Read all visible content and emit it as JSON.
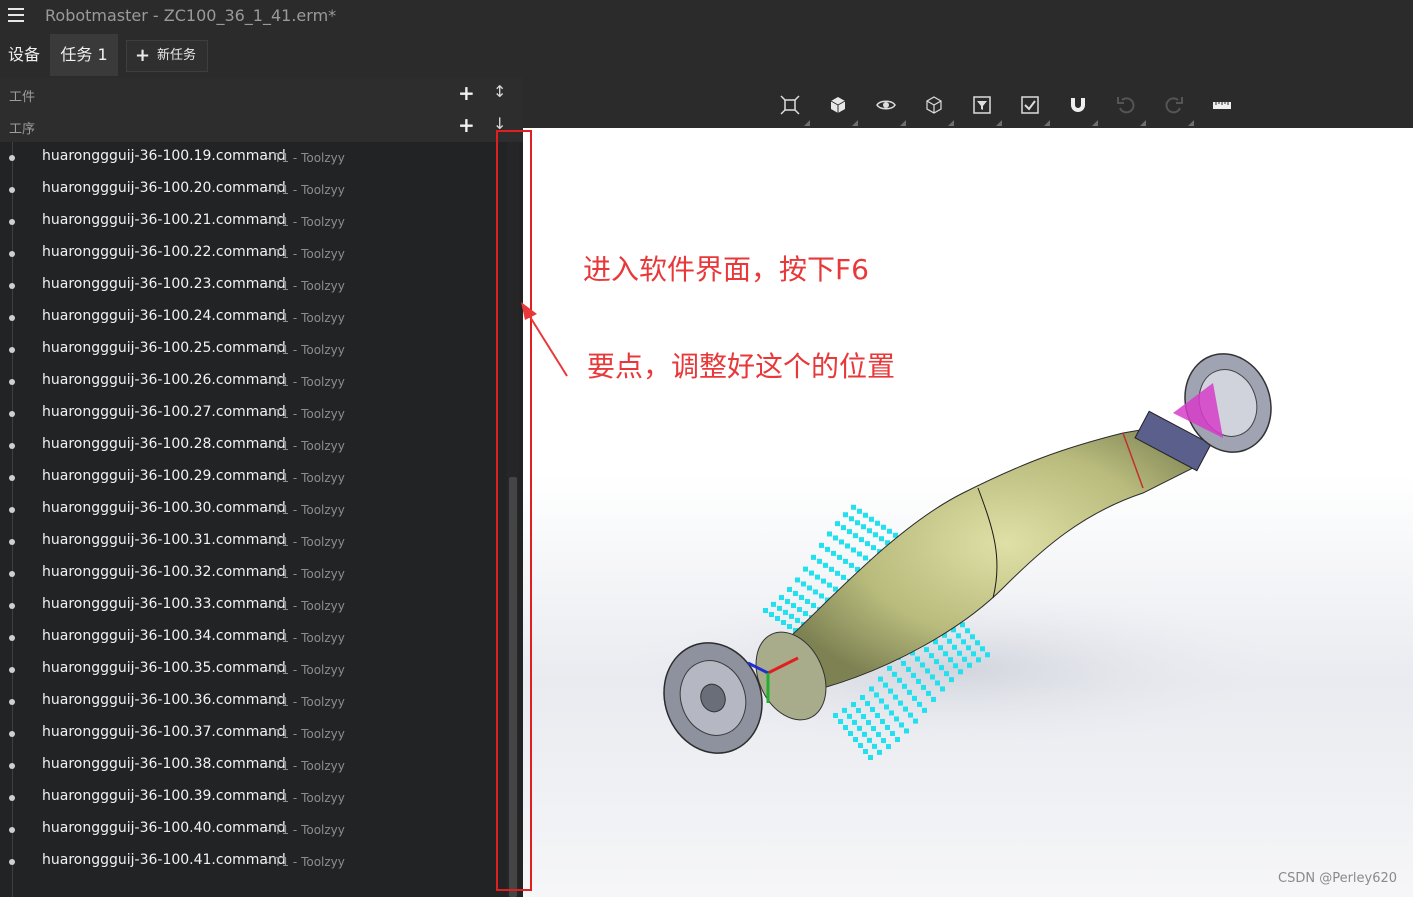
{
  "app": {
    "title": "Robotmaster - ZC100_36_1_41.erm*"
  },
  "tabs": {
    "device": "设备",
    "task": "任务 1",
    "new_task": "新任务"
  },
  "sections": {
    "workpiece": "工件",
    "process": "工序"
  },
  "operations": [
    {
      "name": "huaronggguij-36-100.19.command",
      "meta": "- T1 - Toolzyy"
    },
    {
      "name": "huaronggguij-36-100.20.command",
      "meta": "- T1 - Toolzyy"
    },
    {
      "name": "huaronggguij-36-100.21.command",
      "meta": "- T1 - Toolzyy"
    },
    {
      "name": "huaronggguij-36-100.22.command",
      "meta": "- T1 - Toolzyy"
    },
    {
      "name": "huaronggguij-36-100.23.command",
      "meta": "- T1 - Toolzyy"
    },
    {
      "name": "huaronggguij-36-100.24.command",
      "meta": "- T1 - Toolzyy"
    },
    {
      "name": "huaronggguij-36-100.25.command",
      "meta": "- T1 - Toolzyy"
    },
    {
      "name": "huaronggguij-36-100.26.command",
      "meta": "- T1 - Toolzyy"
    },
    {
      "name": "huaronggguij-36-100.27.command",
      "meta": "- T1 - Toolzyy"
    },
    {
      "name": "huaronggguij-36-100.28.command",
      "meta": "- T1 - Toolzyy"
    },
    {
      "name": "huaronggguij-36-100.29.command",
      "meta": "- T1 - Toolzyy"
    },
    {
      "name": "huaronggguij-36-100.30.command",
      "meta": "- T1 - Toolzyy"
    },
    {
      "name": "huaronggguij-36-100.31.command",
      "meta": "- T1 - Toolzyy"
    },
    {
      "name": "huaronggguij-36-100.32.command",
      "meta": "- T1 - Toolzyy"
    },
    {
      "name": "huaronggguij-36-100.33.command",
      "meta": "- T1 - Toolzyy"
    },
    {
      "name": "huaronggguij-36-100.34.command",
      "meta": "- T1 - Toolzyy"
    },
    {
      "name": "huaronggguij-36-100.35.command",
      "meta": "- T1 - Toolzyy"
    },
    {
      "name": "huaronggguij-36-100.36.command",
      "meta": "- T1 - Toolzyy"
    },
    {
      "name": "huaronggguij-36-100.37.command",
      "meta": "- T1 - Toolzyy"
    },
    {
      "name": "huaronggguij-36-100.38.command",
      "meta": "- T1 - Toolzyy"
    },
    {
      "name": "huaronggguij-36-100.39.command",
      "meta": "- T1 - Toolzyy"
    },
    {
      "name": "huaronggguij-36-100.40.command",
      "meta": "- T1 - Toolzyy"
    },
    {
      "name": "huaronggguij-36-100.41.command",
      "meta": "- T1 - Toolzyy"
    }
  ],
  "toolbar_icons": [
    "fit-view-icon",
    "shaded-cube-icon",
    "eye-icon",
    "wireframe-cube-icon",
    "filter-icon",
    "checkbox-icon",
    "magnet-icon",
    "undo-icon",
    "redo-icon",
    "ruler-icon"
  ],
  "annotations": {
    "line1": "进入软件界面，按下F6",
    "line2": "要点，调整好这个的位置"
  },
  "watermark": "CSDN @Perley620",
  "colors": {
    "annotation": "#e8383a",
    "toolpath": "#22e0ee",
    "part": "#b8bb7c"
  }
}
